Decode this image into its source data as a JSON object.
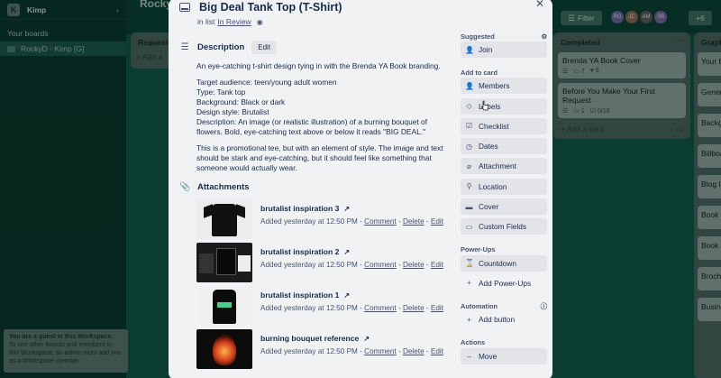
{
  "workspace": {
    "name": "Kimp",
    "logo_letter": "K",
    "your_boards_label": "Your boards",
    "board_item": "RockyD - Kimp [G]",
    "guest_title": "You are a guest in this Workspace.",
    "guest_text": "To see other boards and members in this Workspace, an admin must add you as a Workspace member."
  },
  "board": {
    "title": "Rocky",
    "filter_label": "Filter",
    "avatars": [
      "RG",
      "JC",
      "AM",
      "SB"
    ],
    "more_members": "+6"
  },
  "lists": {
    "requests": {
      "title": "Requests",
      "add": "+ Add a"
    },
    "completed": {
      "title": "Completed",
      "cards": [
        {
          "title": "Brenda YA Book Cover",
          "meta": [
            "☰",
            "▭ 7",
            "♥ 6"
          ]
        },
        {
          "title": "Before You Make Your First Request",
          "meta": [
            "☰",
            "▭ 1",
            "☑ 0/10"
          ]
        }
      ],
      "add": "+ Add a card"
    },
    "graphics": {
      "title": "Graphi",
      "cards": [
        "Your B",
        "Genera",
        "Backgr",
        "Billboa",
        "Blog In",
        "Book C",
        "Book C",
        "Brochu",
        "Busine"
      ]
    }
  },
  "modal": {
    "title": "Big Deal Tank Top (T-Shirt)",
    "in_list_prefix": "in list",
    "list_name": "In Review",
    "description": {
      "label": "Description",
      "edit_label": "Edit",
      "p1": "An eye-catching t-shirt design tying in with the Brenda YA Book branding.",
      "p2_lines": [
        "Target audience: teen/young adult women",
        "Type: Tank top",
        "Background: Black or dark",
        "Design style: Brutalist",
        "Description: An image (or realistic illustration) of a burning bouquet of flowers. Bold, eye-catching text above or below it reads \"BIG DEAL.\""
      ],
      "p3": "This is a promotional tee, but with an element of style. The image and text should be stark and eye-catching, but it should feel like something that someone would actually wear."
    },
    "attachments": {
      "label": "Attachments",
      "items": [
        {
          "name": "brutalist inspiration 3",
          "added": "Added yesterday at 12:50 PM -"
        },
        {
          "name": "brutalist inspiration 2",
          "added": "Added yesterday at 12:50 PM -"
        },
        {
          "name": "brutalist inspiration 1",
          "added": "Added yesterday at 12:50 PM -"
        },
        {
          "name": "burning bouquet reference",
          "added": "Added yesterday at 12:50 PM -"
        }
      ],
      "comment_label": "Comment",
      "delete_label": "Delete",
      "edit_label": "Edit",
      "sep": "-"
    },
    "sidebar": {
      "suggested_label": "Suggested",
      "join_label": "Join",
      "add_to_card_label": "Add to card",
      "add_items": [
        "Members",
        "Labels",
        "Checklist",
        "Dates",
        "Attachment",
        "Location",
        "Cover",
        "Custom Fields"
      ],
      "powerups_label": "Power-Ups",
      "countdown_label": "Countdown",
      "add_powerups_label": "Add Power-Ups",
      "automation_label": "Automation",
      "add_button_label": "Add button",
      "actions_label": "Actions",
      "move_label": "Move"
    }
  }
}
